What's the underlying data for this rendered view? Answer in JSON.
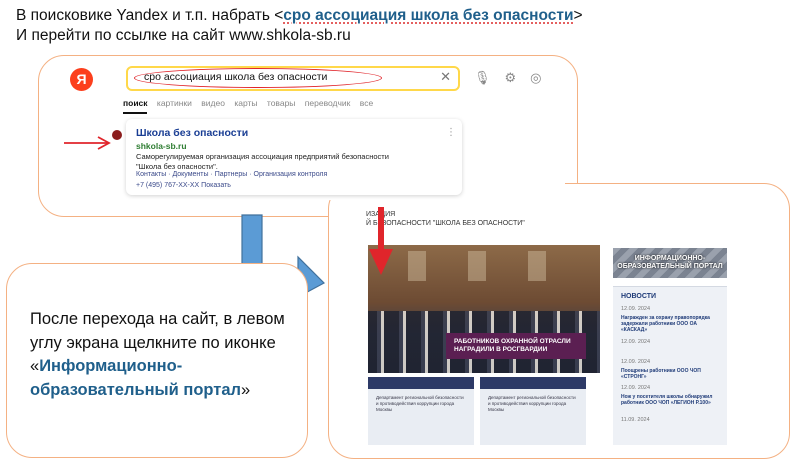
{
  "instructions": {
    "line1_prefix": "В поисковике Yandex и т.п. набрать  <",
    "line1_query": "сро ассоциация  школа без опасности",
    "line1_suffix": ">",
    "line2": "И перейти по ссылке на сайт www.shkola-sb.ru"
  },
  "yandex": {
    "logo": "Я",
    "query": "сро ассоциация школа без опасности",
    "clear_icon": "close-icon",
    "tools_icons": [
      "microphone-icon",
      "settings-icon",
      "camera-icon"
    ],
    "tabs": [
      {
        "label": "поиск",
        "active": true
      },
      {
        "label": "картинки",
        "active": false
      },
      {
        "label": "видео",
        "active": false
      },
      {
        "label": "карты",
        "active": false
      },
      {
        "label": "товары",
        "active": false
      },
      {
        "label": "переводчик",
        "active": false
      },
      {
        "label": "все",
        "active": false
      }
    ],
    "result": {
      "title": "Школа без опасности",
      "url": "shkola-sb.ru",
      "description": "Саморегулируемая организация ассоциация предприятий безопасности \"Школа без опасности\".",
      "links": "Контакты · Документы · Партнеры · Организация контроля",
      "phone": "+7 (495) 767-XX-XX Показать"
    },
    "accent": "#fc3f1d",
    "search_border": "#ffd84a",
    "highlight_oval": "#e0252b"
  },
  "site": {
    "header_line1": "ИЗАЦИЯ",
    "header_line2": "Й БЕЗОПАСНОСТИ \"ШКОЛА БЕЗ ОПАСНОСТИ\"",
    "photo_caption": "РАБОТНИКОВ ОХРАННОЙ ОТРАСЛИ НАГРАДИЛИ В РОСГВАРДИИ",
    "thumb1_text": "Департамент региональной безопасности и противодействия коррупции города Москвы",
    "thumb2_text": "Департамент региональной безопасности и противодействия коррупции города Москвы",
    "portal_label": "ИНФОРМАЦИОННО-ОБРАЗОВАТЕЛЬНЫЙ ПОРТАЛ",
    "news_title": "НОВОСТИ",
    "news": [
      {
        "date": "12.09. 2024",
        "text": "Награжден за охрану правопорядка задержали работники ООО ОА «КАСКАД»"
      },
      {
        "date": "12.09. 2024",
        "text": ""
      },
      {
        "date": "12.09. 2024",
        "text": "Поощрены работники ООО ЧОП «СТРОНГ»"
      },
      {
        "date": "12.09. 2024",
        "text": "Нож у посетителя школы обнаружил работник ООО ЧОП «ЛЕГИОН Р.100»"
      },
      {
        "date": "11.09. 2024",
        "text": ""
      }
    ]
  },
  "note": {
    "text_prefix": "После перехода на сайт, в левом углу экрана щелкните по иконке «",
    "highlight": "Информационно-образовательный портал",
    "text_suffix": "»"
  }
}
